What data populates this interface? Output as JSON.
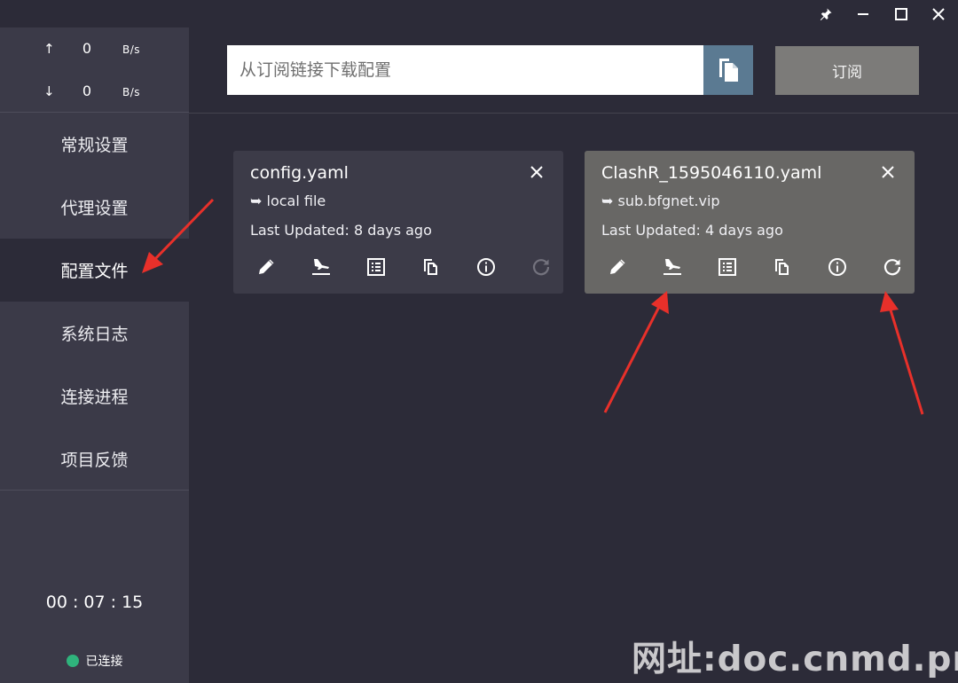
{
  "window": {
    "controls": [
      {
        "name": "pin-icon"
      },
      {
        "name": "minimize-icon"
      },
      {
        "name": "maximize-icon"
      },
      {
        "name": "close-icon"
      }
    ]
  },
  "traffic": {
    "upload": {
      "arrow": "↑",
      "value": "0",
      "unit": "B/s"
    },
    "download": {
      "arrow": "↓",
      "value": "0",
      "unit": "B/s"
    }
  },
  "nav": {
    "items": [
      {
        "label": "常规设置"
      },
      {
        "label": "代理设置"
      },
      {
        "label": "配置文件",
        "active": true
      },
      {
        "label": "系统日志"
      },
      {
        "label": "连接进程"
      },
      {
        "label": "项目反馈"
      }
    ]
  },
  "status": {
    "uptime": "00 : 07 : 15",
    "connection": "已连接",
    "connection_color": "#2fb37c"
  },
  "subscribe": {
    "placeholder": "从订阅链接下载配置",
    "button_label": "订阅",
    "paste_icon": "paste-icon"
  },
  "profiles": [
    {
      "name": "config.yaml",
      "source": "➥ local file",
      "updated": "Last Updated: 8 days ago",
      "selected": false,
      "background": "#3c3b48"
    },
    {
      "name": "ClashR_1595046110.yaml",
      "source": "➥ sub.bfgnet.vip",
      "updated": "Last Updated: 4 days ago",
      "selected": true,
      "background": "#686765"
    }
  ],
  "card_actions": [
    "edit-icon",
    "import-icon",
    "list-icon",
    "copy-icon",
    "info-icon",
    "refresh-icon"
  ],
  "watermark": "网址:doc.cnmd.pro",
  "colors": {
    "background": "#2c2b38",
    "sidebar": "#3b3a48",
    "accent_blue": "#5b7a92",
    "annotation_red": "#e8302a"
  }
}
